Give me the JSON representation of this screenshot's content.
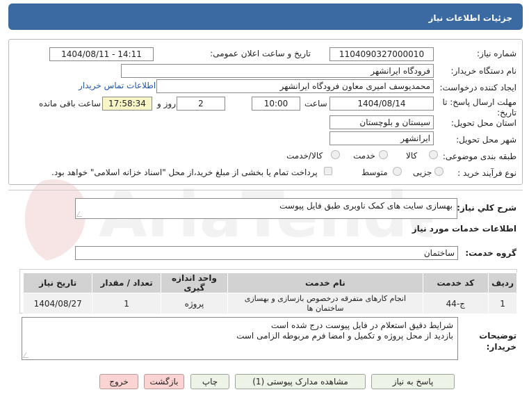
{
  "header": {
    "title": "جزئیات اطلاعات نیاز"
  },
  "labels": {
    "need_number": "شماره نیاز:",
    "announce_datetime": "تاریخ و ساعت اعلان عمومی:",
    "buyer_org": "نام دستگاه خریدار:",
    "requester": "ایجاد کننده درخواست:",
    "buyer_contact_link": "اطلاعات تماس خریدار",
    "deadline": "مهلت ارسال پاسخ: تا تاریخ:",
    "time": "ساعت",
    "days_and": "روز و",
    "time_left": "ساعت باقی مانده",
    "province": "استان محل تحویل:",
    "city": "شهر محل تحویل:",
    "category": "طبقه بندی موضوعی:",
    "process_type": "نوع فرآیند خرید :",
    "payment_note": "پرداخت تمام یا بخشی از مبلغ خرید،از محل \"اسناد خزانه اسلامی\" خواهد بود.",
    "general_desc": "شرح کلي نياز:",
    "services_info": "اطلاعات خدمات مورد نیاز",
    "service_group": "گروه خدمت:",
    "buyer_notes": "توضیحات خریدار:"
  },
  "values": {
    "need_number": "1104090327000010",
    "announce_datetime": "1404/08/11 - 14:11",
    "buyer_org": "فرودگاه ایرانشهر",
    "requester": "محمدیوسف امیری معاون فرودگاه ایرانشهر",
    "deadline_date": "1404/08/14",
    "deadline_time": "10:00",
    "days": "2",
    "remaining": "17:58:34",
    "province": "سیستان و بلوچستان",
    "city": "ایرانشهر",
    "general_desc": "بهسازی سایت های کمک ناوبری طبق فایل پیوست",
    "service_group": "ساختمان",
    "buyer_notes_line1": "شرایط دقیق استعلام در فایل پیوست درج شده است",
    "buyer_notes_line2": "بازدید از محل پروژه و تکمیل و امضا فرم مربوطه الزامی است"
  },
  "category_options": [
    "کالا",
    "خدمت",
    "کالا/خدمت"
  ],
  "process_options": [
    "جزیی",
    "متوسط"
  ],
  "table": {
    "headers": [
      "ردیف",
      "کد خدمت",
      "نام خدمت",
      "واحد اندازه گیری",
      "تعداد / مقدار",
      "تاریخ نیاز"
    ],
    "rows": [
      [
        "1",
        "ج-44",
        "انجام کارهای متفرقه درخصوص بازسازی و بهسازی ساختمان ها",
        "پروژه",
        "1",
        "1404/08/27"
      ]
    ]
  },
  "buttons": {
    "reply": "پاسخ به نیاز",
    "view_docs": "مشاهده مدارک پیوستی (1)",
    "print": "چاپ",
    "back": "بازگشت",
    "exit": "خروج"
  },
  "watermark": "AriaTender.neT"
}
